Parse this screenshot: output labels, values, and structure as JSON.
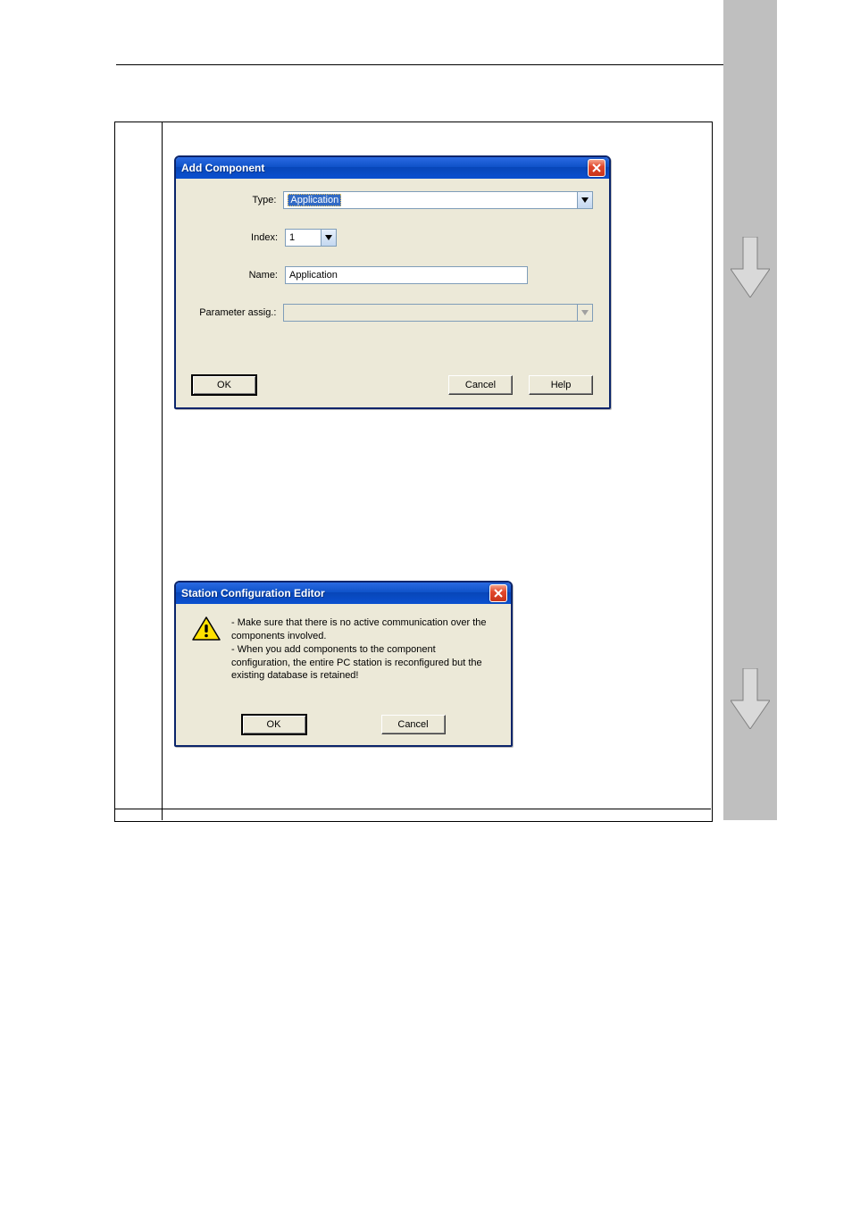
{
  "dialog1": {
    "title": "Add Component",
    "labels": {
      "type": "Type:",
      "index": "Index:",
      "name": "Name:",
      "param": "Parameter assig.:"
    },
    "values": {
      "type": "Application",
      "index": "1",
      "name": "Application",
      "param": ""
    },
    "buttons": {
      "ok": "OK",
      "cancel": "Cancel",
      "help": "Help"
    }
  },
  "dialog2": {
    "title": "Station Configuration Editor",
    "message": "- Make sure that there is no active communication over the components involved.\n- When you add components to the component configuration, the entire PC station is reconfigured but the existing database is retained!",
    "buttons": {
      "ok": "OK",
      "cancel": "Cancel"
    }
  }
}
